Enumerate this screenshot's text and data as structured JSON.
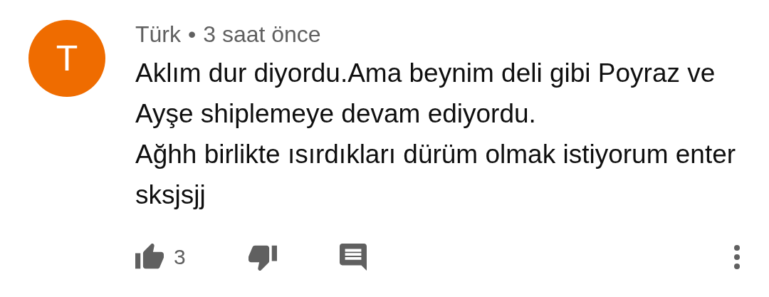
{
  "comment": {
    "avatar": {
      "letter": "T",
      "color": "#ef6c00"
    },
    "author": "Türk",
    "separator": "•",
    "time": "3 saat önce",
    "text": "Aklım dur diyordu.Ama beynim deli gibi Poyraz ve Ayşe shiplemeye devam ediyordu.\nAğhh birlikte ısırdıkları dürüm olmak istiyorum enter sksjsjj",
    "like_count": "3"
  }
}
